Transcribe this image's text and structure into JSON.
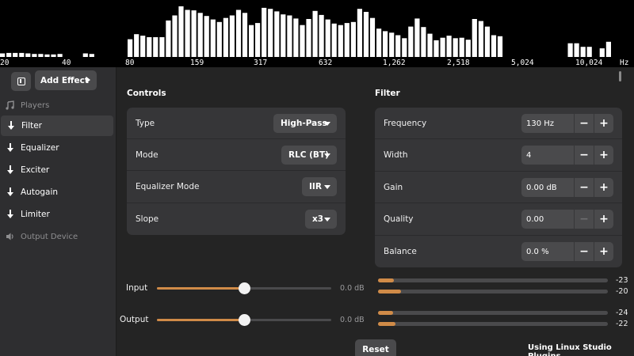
{
  "spectrum": {
    "bars": [
      0.07,
      0.08,
      0.08,
      0.08,
      0.07,
      0.06,
      0.06,
      0.05,
      0.05,
      0.06,
      0.0,
      0.0,
      0.0,
      0.07,
      0.06,
      0.0,
      0.0,
      0.0,
      0.0,
      0.0,
      0.35,
      0.45,
      0.42,
      0.39,
      0.39,
      0.39,
      0.72,
      0.82,
      1.0,
      0.93,
      0.92,
      0.87,
      0.81,
      0.74,
      0.69,
      0.77,
      0.82,
      0.93,
      0.87,
      0.63,
      0.67,
      0.97,
      0.95,
      0.9,
      0.84,
      0.82,
      0.76,
      0.63,
      0.75,
      0.91,
      0.83,
      0.74,
      0.66,
      0.63,
      0.67,
      0.69,
      0.95,
      0.89,
      0.77,
      0.56,
      0.51,
      0.48,
      0.43,
      0.37,
      0.6,
      0.76,
      0.59,
      0.46,
      0.33,
      0.38,
      0.42,
      0.37,
      0.38,
      0.34,
      0.75,
      0.71,
      0.6,
      0.43,
      0.41,
      0.0,
      0.0,
      0.0,
      0.0,
      0.0,
      0.0,
      0.0,
      0.0,
      0.0,
      0.0,
      0.27,
      0.27,
      0.2,
      0.2,
      0.0,
      0.17,
      0.3,
      0.0
    ],
    "freq_labels": [
      "20",
      "40",
      "80",
      "159",
      "317",
      "632",
      "1,262",
      "2,518",
      "5,024",
      "10,024",
      "Hz"
    ]
  },
  "sidebar": {
    "add_effect_label": "Add Effect",
    "players_label": "Players",
    "items": [
      {
        "label": "Filter",
        "selected": true
      },
      {
        "label": "Equalizer",
        "selected": false
      },
      {
        "label": "Exciter",
        "selected": false
      },
      {
        "label": "Autogain",
        "selected": false
      },
      {
        "label": "Limiter",
        "selected": false
      }
    ],
    "output_device_label": "Output Device"
  },
  "controls": {
    "title": "Controls",
    "rows": [
      {
        "label": "Type",
        "value": "High-Pass"
      },
      {
        "label": "Mode",
        "value": "RLC (BT)"
      },
      {
        "label": "Equalizer Mode",
        "value": "IIR"
      },
      {
        "label": "Slope",
        "value": "x3"
      }
    ]
  },
  "filter": {
    "title": "Filter",
    "rows": [
      {
        "label": "Frequency",
        "value": "130 Hz"
      },
      {
        "label": "Width",
        "value": "4"
      },
      {
        "label": "Gain",
        "value": "0.00 dB"
      },
      {
        "label": "Quality",
        "value": "0.00"
      },
      {
        "label": "Balance",
        "value": "0.0 %"
      }
    ]
  },
  "gain": {
    "input_label": "Input",
    "input_value": "0.0 dB",
    "input_level": 0.5,
    "output_label": "Output",
    "output_value": "0.0 dB",
    "output_level": 0.5
  },
  "meters": {
    "input": [
      {
        "value": "-23",
        "level": 0.07
      },
      {
        "value": "-20",
        "level": 0.1
      }
    ],
    "output": [
      {
        "value": "-24",
        "level": 0.065
      },
      {
        "value": "-22",
        "level": 0.075
      }
    ]
  },
  "footer": {
    "reset_label": "Reset",
    "plugin_label": "Using Linux Studio Plugins"
  },
  "colors": {
    "accent": "#d08b48",
    "background": "#242424",
    "card": "#363638",
    "button": "#4a4a4c"
  }
}
